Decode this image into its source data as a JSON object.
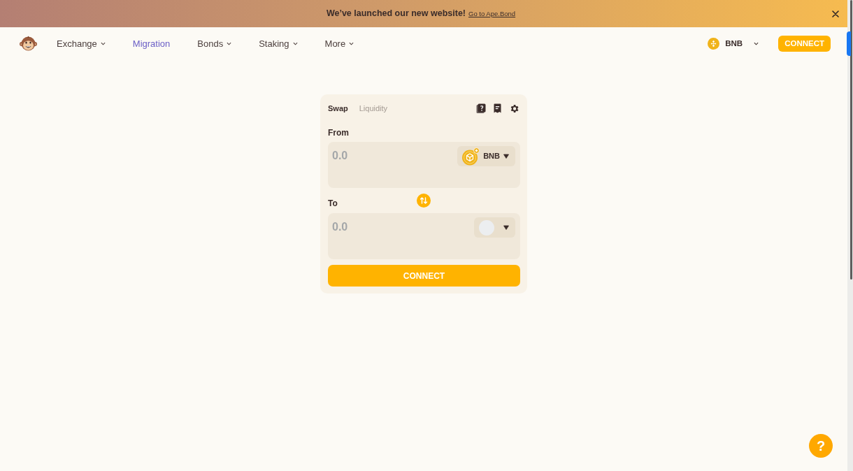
{
  "banner": {
    "message": "We’ve launched our new website!",
    "link": "Go to Ape.Bond"
  },
  "navbar": {
    "items": [
      {
        "label": "Exchange",
        "dropdown": true,
        "selected": false
      },
      {
        "label": "Migration",
        "dropdown": false,
        "selected": true
      },
      {
        "label": "Bonds",
        "dropdown": true,
        "selected": false
      },
      {
        "label": "Staking",
        "dropdown": true,
        "selected": false
      },
      {
        "label": "More",
        "dropdown": true,
        "selected": false
      }
    ],
    "network": {
      "label": "BNB"
    },
    "connect_button": "CONNECT"
  },
  "swap_card": {
    "tabs": [
      {
        "label": "Swap",
        "selected": true
      },
      {
        "label": "Liquidity",
        "selected": false
      }
    ],
    "from": {
      "label": "From",
      "placeholder": "0.0",
      "token": "BNB"
    },
    "to": {
      "label": "To",
      "placeholder": "0.0"
    },
    "button": "CONNECT"
  },
  "help_button": "?"
}
